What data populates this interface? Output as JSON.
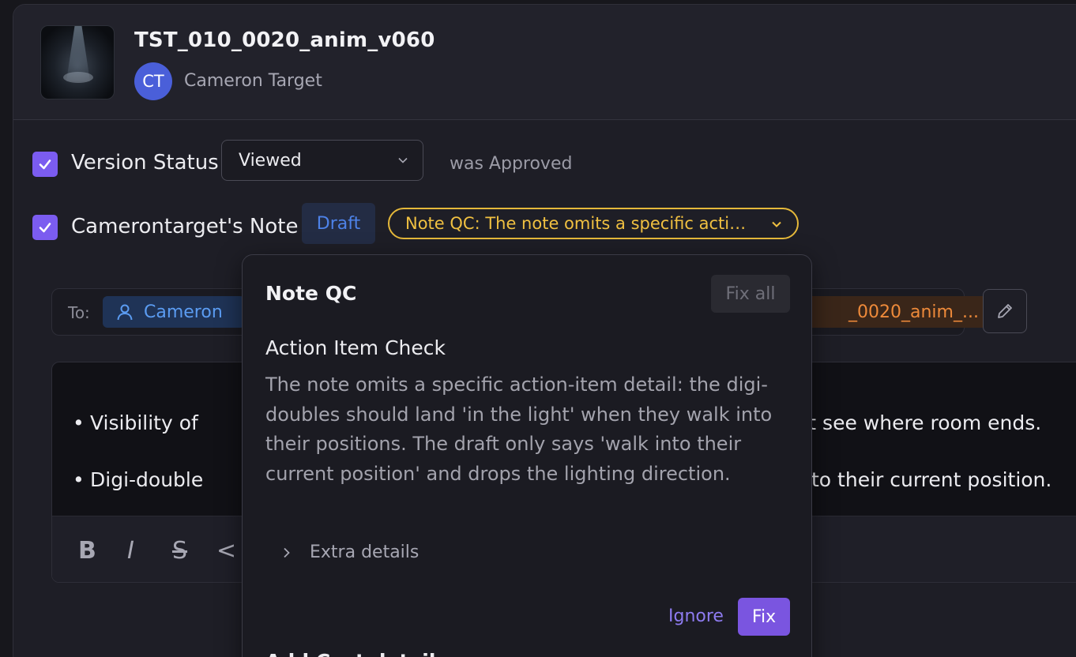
{
  "header": {
    "version_title": "TST_010_0020_anim_v060",
    "user_initials": "CT",
    "user_name": "Cameron Target",
    "avatar_color": "#4a5fd9"
  },
  "status_row": {
    "label": "Version Status",
    "checked": true,
    "select_value": "Viewed",
    "suffix": "was Approved"
  },
  "note_row": {
    "label": "Camerontarget's Note",
    "checked": true,
    "draft_badge": "Draft",
    "qc_pill": "Note QC: The note omits a specific acti…"
  },
  "recipients": {
    "to_label": "To:",
    "to_chip": "Cameron",
    "version_chip": "_0020_anim_..."
  },
  "editor": {
    "bullets": [
      "Visibility of",
      "ot see where room ends.",
      "Digi-double",
      "to their current position."
    ],
    "toolbar": [
      "B",
      "I",
      "S",
      "<"
    ]
  },
  "popover": {
    "title": "Note QC",
    "fix_all": "Fix all",
    "check_title": "Action Item Check",
    "check_body": "The note omits a specific action-item detail: the digi-doubles should land 'in the light' when they walk into their positions. The draft only says 'walk into their current position' and drops the lighting direction.",
    "extra_details": "Extra details",
    "ignore": "Ignore",
    "fix": "Fix",
    "next_check_title": "Add Cast details"
  },
  "colors": {
    "accent": "#7b5cf0",
    "qc_warning": "#e5b83a",
    "draft_blue": "#4d82e8",
    "version_orange": "#ee8a3a"
  }
}
